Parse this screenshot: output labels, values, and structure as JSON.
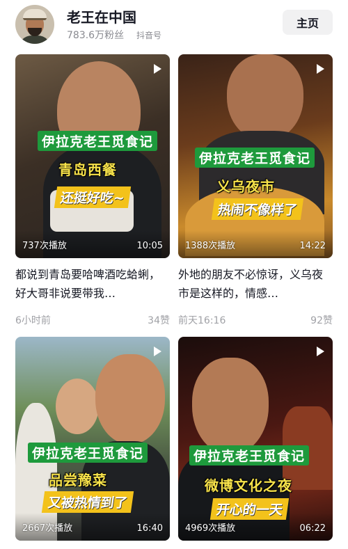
{
  "profile": {
    "name": "老王在中国",
    "fans": "783.6万粉丝",
    "platform": "抖音号",
    "home_button": "主页"
  },
  "videos": [
    {
      "series_caption": "伊拉克老王觅食记",
      "place_caption": "青岛西餐",
      "tag_caption": "还挺好吃~",
      "plays": "737次播放",
      "duration": "10:05",
      "title": "都说到青岛要哈啤酒吃蛤蜊，好大哥非说要带我…",
      "time": "6小时前",
      "likes": "34赞"
    },
    {
      "series_caption": "伊拉克老王觅食记",
      "place_caption": "义乌夜市",
      "tag_caption": "热闹不像样了",
      "plays": "1388次播放",
      "duration": "14:22",
      "title": "外地的朋友不必惊讶，义乌夜市是这样的，情感…",
      "time": "前天16:16",
      "likes": "92赞"
    },
    {
      "series_caption": "伊拉克老王觅食记",
      "place_caption": "品尝豫菜",
      "tag_caption": "又被热情到了",
      "plays": "2667次播放",
      "duration": "16:40",
      "title": "",
      "time": "",
      "likes": ""
    },
    {
      "series_caption": "伊拉克老王觅食记",
      "place_caption": "微博文化之夜",
      "tag_caption": "开心的一天",
      "plays": "4969次播放",
      "duration": "06:22",
      "title": "",
      "time": "",
      "likes": ""
    }
  ],
  "colors": {
    "caption_green": "#1e9a3c",
    "caption_yellow": "#f7e24a",
    "tag_yellow": "#f3c21b",
    "meta_gray": "#a0a1a6"
  }
}
